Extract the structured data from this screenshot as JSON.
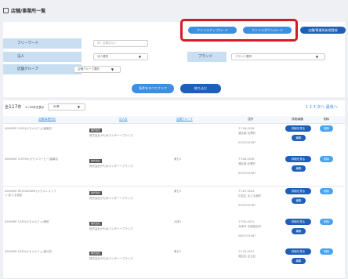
{
  "page": {
    "title": "店舗/事業所一覧"
  },
  "top_buttons": {
    "upload": "ファイルアップロード",
    "download": "ファイルダウンロード",
    "add": "店舗/事業所新規登録"
  },
  "filters": {
    "free_word_label": "フリーワード",
    "free_word_placeholder": "例）店舗名など",
    "corp_label": "法人",
    "corp_value": "法人選択",
    "brand_label": "ブランド",
    "brand_value": "ブランド選択",
    "group_label": "店舗グループ",
    "group_value": "店舗グループ選択"
  },
  "actions": {
    "clear": "条件をすべてクリア",
    "search": "絞り込む"
  },
  "list": {
    "count_prefix": "全",
    "count": "117",
    "count_suffix": "件",
    "range": "1〜50件を表示",
    "per_page": "50件",
    "pager": "1  2  3  次へ  最後へ"
  },
  "columns": {
    "shop": "店舗/事業所名",
    "corp": "法人名",
    "group": "店舗グループ",
    "address": "住所",
    "detail": "詳細/編集",
    "delete": "削除"
  },
  "rows": [
    {
      "shop": "KAMOME CAFE(カモメカフェ)猛暑店",
      "corp_badge": "株式会社",
      "corp": "株式会社かもめエンターープライズ",
      "group": "",
      "zip": "〒106-0036",
      "addr": "港区麻 北黒町",
      "tel": "0301234567"
    },
    {
      "shop": "KAMOME COFFEE(カモメコーヒー)猛暑店",
      "corp_badge": "株式会社",
      "corp": "株式会社かもめエンターープライズ",
      "group": "東日1",
      "zip": "〒106-0036",
      "addr": "港区麻 北黒町",
      "tel": "0301234567"
    },
    {
      "shop": "KAMOME RESTAURANT(カモメレストラン)あさる酒店",
      "corp_badge": "株式会社",
      "corp": "株式会社かもめエンターープライズ",
      "group": "東日1",
      "zip": "〒167-0054",
      "addr": "杉並区 あさる酒町",
      "tel": "0301234567"
    },
    {
      "shop": "KAMOME CAFE(カモメカフェ)梅田",
      "corp_badge": "株式会社",
      "corp": "株式会社かもめエンターープライズ",
      "group": "大阪1",
      "zip": "〒535-0031",
      "addr": "大阪市 天満西区町",
      "tel": "0601234567"
    },
    {
      "shop": "KAMOME CAFE(カモメカフェ)東日店",
      "corp_badge": "株式会社",
      "corp": "株式会社かもめエンターープライズ",
      "group": "東日1",
      "zip": "〒120-0031",
      "addr": "港区区 足立区",
      "tel": ""
    }
  ],
  "row_buttons": {
    "detail": "詳細を見る",
    "edit": "編集",
    "delete": "削除"
  }
}
